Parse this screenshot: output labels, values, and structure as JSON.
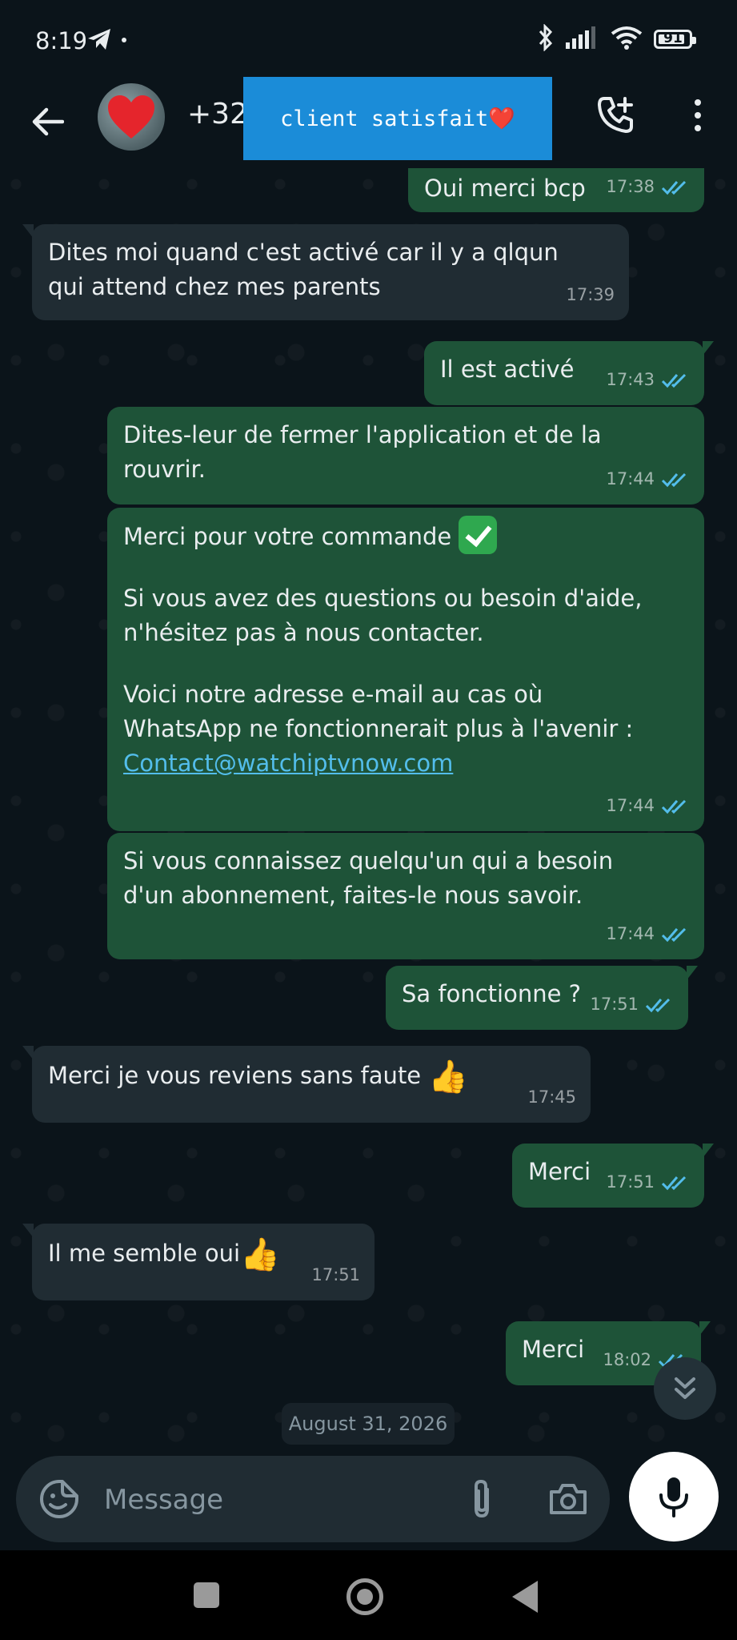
{
  "status_bar": {
    "time": "8:19",
    "battery": "91",
    "battery_level": 0.91
  },
  "header": {
    "contact_name": "+32",
    "overlay_label": "client satisfait❤️"
  },
  "messages": [
    {
      "dir": "out",
      "text": "Oui merci bcp",
      "time": "17:38"
    },
    {
      "dir": "in",
      "text": "Dites moi quand c'est activé car il y a qlqun\nqui attend chez mes parents",
      "time": "17:39"
    },
    {
      "dir": "out",
      "text": "Il est activé",
      "time": "17:43"
    },
    {
      "dir": "out",
      "text": "Dites-leur de fermer l'application et de la\nrouvrir.",
      "time": "17:44"
    },
    {
      "dir": "out",
      "line1": "Merci pour votre commande",
      "line2": "Si vous avez des questions ou besoin d'aide,\nn'hésitez pas à nous contacter.",
      "line3": "Voici notre adresse e-mail au cas où\nWhatsApp ne fonctionnerait plus à l'avenir :",
      "link": "Contact@watchiptvnow.com",
      "time": "17:44"
    },
    {
      "dir": "out",
      "text": "Si vous connaissez quelqu'un qui a besoin\nd'un abonnement, faites-le nous savoir.",
      "time": "17:44"
    },
    {
      "dir": "out",
      "text": "Sa fonctionne ?",
      "time": "17:51"
    },
    {
      "dir": "in",
      "text": "Merci je vous reviens sans faute",
      "time": "17:45"
    },
    {
      "dir": "out",
      "text": "Merci",
      "time": "17:51"
    },
    {
      "dir": "in",
      "text": "Il me semble oui",
      "time": "17:51"
    },
    {
      "dir": "out",
      "text": "Merci",
      "time": "18:02"
    }
  ],
  "date_chip": "August 31, 2026",
  "composer": {
    "placeholder": "Message"
  },
  "colors": {
    "outgoing": "#1e5338",
    "incoming": "#202c33",
    "background": "#0b141a",
    "tick_read": "#53bdeb",
    "overlay": "#1b8cd8"
  }
}
